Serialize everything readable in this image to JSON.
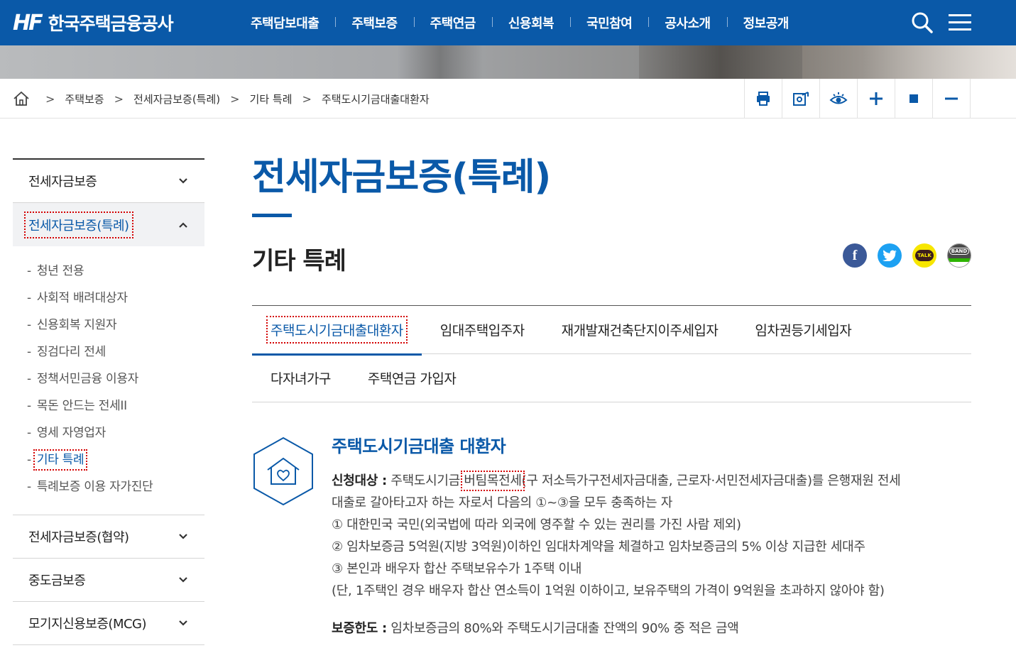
{
  "header": {
    "logo_mark": "HF",
    "logo_text": "한국주택금융공사",
    "menu": [
      "주택담보대출",
      "주택보증",
      "주택연금",
      "신용회복",
      "국민참여",
      "공사소개",
      "정보공개"
    ],
    "search_icon": "search-icon",
    "menu_icon": "hamburger-icon"
  },
  "breadcrumb": {
    "items": [
      "주택보증",
      "전세자금보증(특례)",
      "기타 특례",
      "주택도시기금대출대환자"
    ],
    "separator": ">"
  },
  "tools": [
    "print-icon",
    "share-icon",
    "view-icon",
    "zoom-in-icon",
    "reset-icon",
    "zoom-out-icon"
  ],
  "sidebar": {
    "categories_top": [
      {
        "label": "전세자금보증",
        "state": "collapsed"
      },
      {
        "label": "전세자금보증(특례)",
        "state": "expanded"
      }
    ],
    "sub_items": [
      "청년 전용",
      "사회적 배려대상자",
      "신용회복 지원자",
      "징검다리 전세",
      "정책서민금융 이용자",
      "목돈 안드는 전세II",
      "영세 자영업자",
      "기타 특례",
      "특례보증 이용 자가진단"
    ],
    "sub_current": "기타 특례",
    "dash": "-",
    "categories_bottom": [
      {
        "label": "전세자금보증(협약)"
      },
      {
        "label": "중도금보증"
      },
      {
        "label": "모기지신용보증(MCG)"
      }
    ]
  },
  "content": {
    "page_title": "전세자금보증(특례)",
    "sub_title": "기타 특례",
    "sns": {
      "facebook": "f",
      "kakao": "TALK",
      "band": "BAND"
    },
    "tabs_row1": [
      "주택도시기금대출대환자",
      "임대주택입주자",
      "재개발재건축단지이주세입자",
      "임차권등기세입자"
    ],
    "tabs_row2": [
      "다자녀가구",
      "주택연금 가입자"
    ],
    "active_tab": "주택도시기금대출대환자",
    "section": {
      "title": "주택도시기금대출 대환자",
      "apply_label": "신청대상 :",
      "apply_pre": " 주택도시기금 ",
      "apply_hl": "버팀목전세",
      "apply_post": "(구 저소득가구전세자금대출, 근로자·서민전세자금대출)를 은행재원 전세",
      "apply_line2": "대출로 갈아타고자 하는 자로서 다음의 ①~③을 모두 충족하는 자",
      "conditions": [
        "① 대한민국 국민(외국법에 따라 외국에 영주할 수 있는 권리를 가진 사람 제외)",
        "② 임차보증금 5억원(지방 3억원)이하인 임대차계약을 체결하고 임차보증금의 5% 이상 지급한 세대주",
        "③ 본인과 배우자 합산 주택보유수가 1주택 이내",
        "(단, 1주택인 경우 배우자 합산 연소득이 1억원 이하이고, 보유주택의 가격이 9억원을 초과하지 않아야 함)"
      ],
      "limit_label": "보증한도 :",
      "limit_text": " 임차보증금의 80%와 주택도시기금대출 잔액의 90% 중 적은 금액"
    }
  },
  "colors": {
    "brand": "#0a59a8",
    "facebook": "#3b5998",
    "twitter": "#1da1f2",
    "kakao": "#f7e600",
    "band": "#4a4a4a"
  }
}
